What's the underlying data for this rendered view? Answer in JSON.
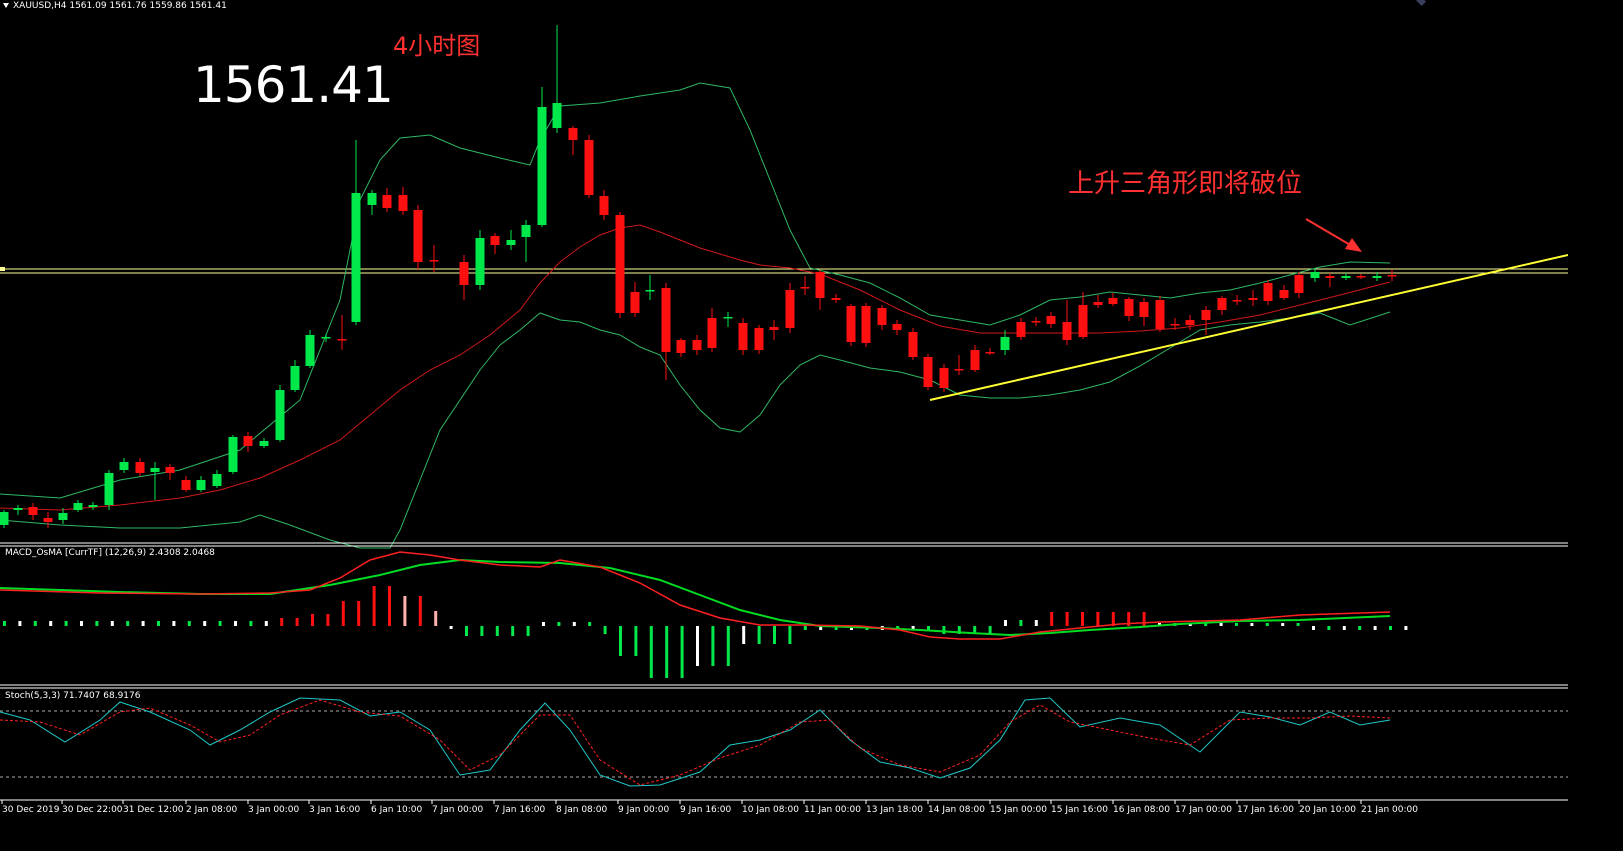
{
  "header": {
    "symbol_info": "XAUUSD,H4  1561.09 1561.76 1559.86 1561.41",
    "current_price": "1561.41",
    "timeframe_label": "4小时图",
    "annotation": "上升三角形即将破位"
  },
  "indicators": {
    "macd_label": "MACD_OsMA [CurrTF] (12,26,9) 2.4308 2.0468",
    "stoch_label": "Stoch(5,3,3) 71.7407 68.9176"
  },
  "time_axis": [
    "30 Dec 2019",
    "30 Dec 22:00",
    "31 Dec 12:00",
    "2 Jan 08:00",
    "3 Jan 00:00",
    "3 Jan 16:00",
    "6 Jan 10:00",
    "7 Jan 00:00",
    "7 Jan 16:00",
    "8 Jan 08:00",
    "9 Jan 00:00",
    "9 Jan 16:00",
    "10 Jan 08:00",
    "11 Jan 00:00",
    "13 Jan 18:00",
    "14 Jan 08:00",
    "15 Jan 00:00",
    "15 Jan 16:00",
    "16 Jan 08:00",
    "17 Jan 00:00",
    "17 Jan 16:00",
    "20 Jan 10:00",
    "21 Jan 00:00"
  ],
  "colors": {
    "bull": "#00e84a",
    "bear": "#ff1010",
    "band": "#2fb865",
    "ma": "#d01818",
    "trend": "#ffff33",
    "hline": "#ffff99",
    "arrow": "#ff3030",
    "macd_main": "#00dd22",
    "macd_signal": "#ff2020",
    "stoch_main": "#20c8c8",
    "stoch_signal": "#ff2020"
  }
}
